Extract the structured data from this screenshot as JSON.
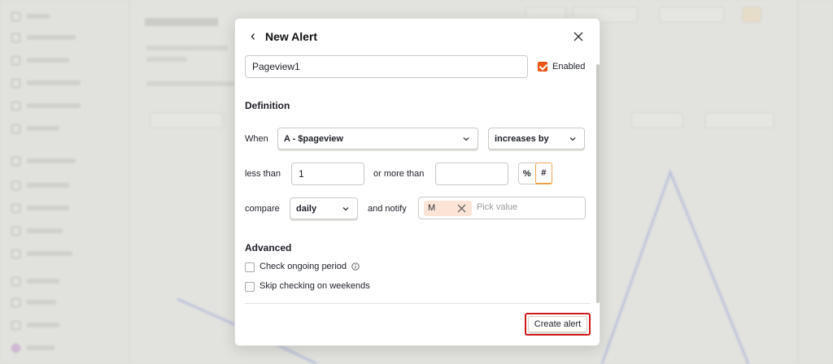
{
  "modal": {
    "title": "New Alert",
    "name_value": "Pageview1",
    "enabled_label": "Enabled",
    "enabled_checked": true,
    "definition_heading": "Definition",
    "when_label": "When",
    "series_select": "A - $pageview",
    "condition_select": "increases by",
    "less_than_label": "less than",
    "less_than_value": "1",
    "more_than_label": "or more than",
    "more_than_value": "",
    "unit_options": [
      "%",
      "#"
    ],
    "unit_selected": "#",
    "compare_label": "compare",
    "compare_select": "daily",
    "notify_label": "and notify",
    "notify_chip": "M",
    "notify_placeholder": "Pick value",
    "advanced_heading": "Advanced",
    "ongoing_label": "Check ongoing period",
    "weekends_label": "Skip checking on weekends",
    "create_button": "Create alert"
  },
  "colors": {
    "accent": "#f05a17",
    "highlight_border": "#d11a1a"
  },
  "icons": [
    "back-chevron-icon",
    "close-icon",
    "chevron-down-icon",
    "info-icon",
    "chip-remove-icon"
  ]
}
